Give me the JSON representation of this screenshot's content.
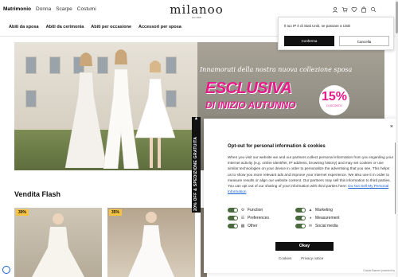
{
  "header": {
    "nav": [
      "Matrimonio",
      "Donna",
      "Scarpe",
      "Costumi"
    ],
    "active_nav": "Matrimonio",
    "logo": "milanoo",
    "logo_sub": "Est 2008",
    "icons": [
      "user-icon",
      "cart-icon",
      "heart-icon",
      "bag-icon",
      "search-icon"
    ]
  },
  "categories": [
    "Abiti da sposa",
    "Abiti da cerimonia",
    "Abiti per occasione",
    "Accessori per sposa"
  ],
  "hero": {
    "caption": "Innamorati della nostra nuova collezione sposa",
    "headline": "ESCLUSIVA",
    "subline": "DI INIZIO AUTUNNO",
    "badge_percent": "15%",
    "badge_label": "DI SCONTO"
  },
  "section": {
    "title": "Vendita Flash",
    "cards": [
      {
        "tag": "30%"
      },
      {
        "tag": "35%"
      },
      {
        "tag": ""
      },
      {
        "tag": ""
      }
    ]
  },
  "side_tab": {
    "label": "20% OFF & SPEDIZIONE GRATUITA"
  },
  "geo_popover": {
    "message": "Il tuo IP è di Stati Uniti, se passare a USD",
    "confirm": "Conferma",
    "cancel": "Cancella"
  },
  "consent": {
    "close_symbol": "×",
    "title": "Opt-out for personal information & cookies",
    "body": "When you visit our website we and our partners collect personal information from you regarding your internet activity (e.g. online identifier, IP address, browsing history) and may set cookies or use similar technologies on your device in order to personalize the advertising that you see. This helps us to show you more relevant ads and improve your internet experience. We also use it in order to measure results or align our website content. Our partners may sell this information to third parties. You can opt out of our sharing of your information with third parties here:",
    "link": "Do Not Sell My Personal Information",
    "toggles": [
      {
        "label": "Function",
        "on": true
      },
      {
        "label": "Marketing",
        "on": true
      },
      {
        "label": "Preferences",
        "on": true
      },
      {
        "label": "Measurement",
        "on": true
      },
      {
        "label": "Other",
        "on": true
      },
      {
        "label": "Social media",
        "on": true
      }
    ],
    "okay": "Okay",
    "cookies_link": "Cookies",
    "privacy_link": "Privacy notice",
    "powered": "Cookie Banner powered by"
  },
  "colors": {
    "accent": "#e8198b",
    "dark": "#111111",
    "toggle_on": "#4b6a3f",
    "tag": "#f6c341"
  }
}
